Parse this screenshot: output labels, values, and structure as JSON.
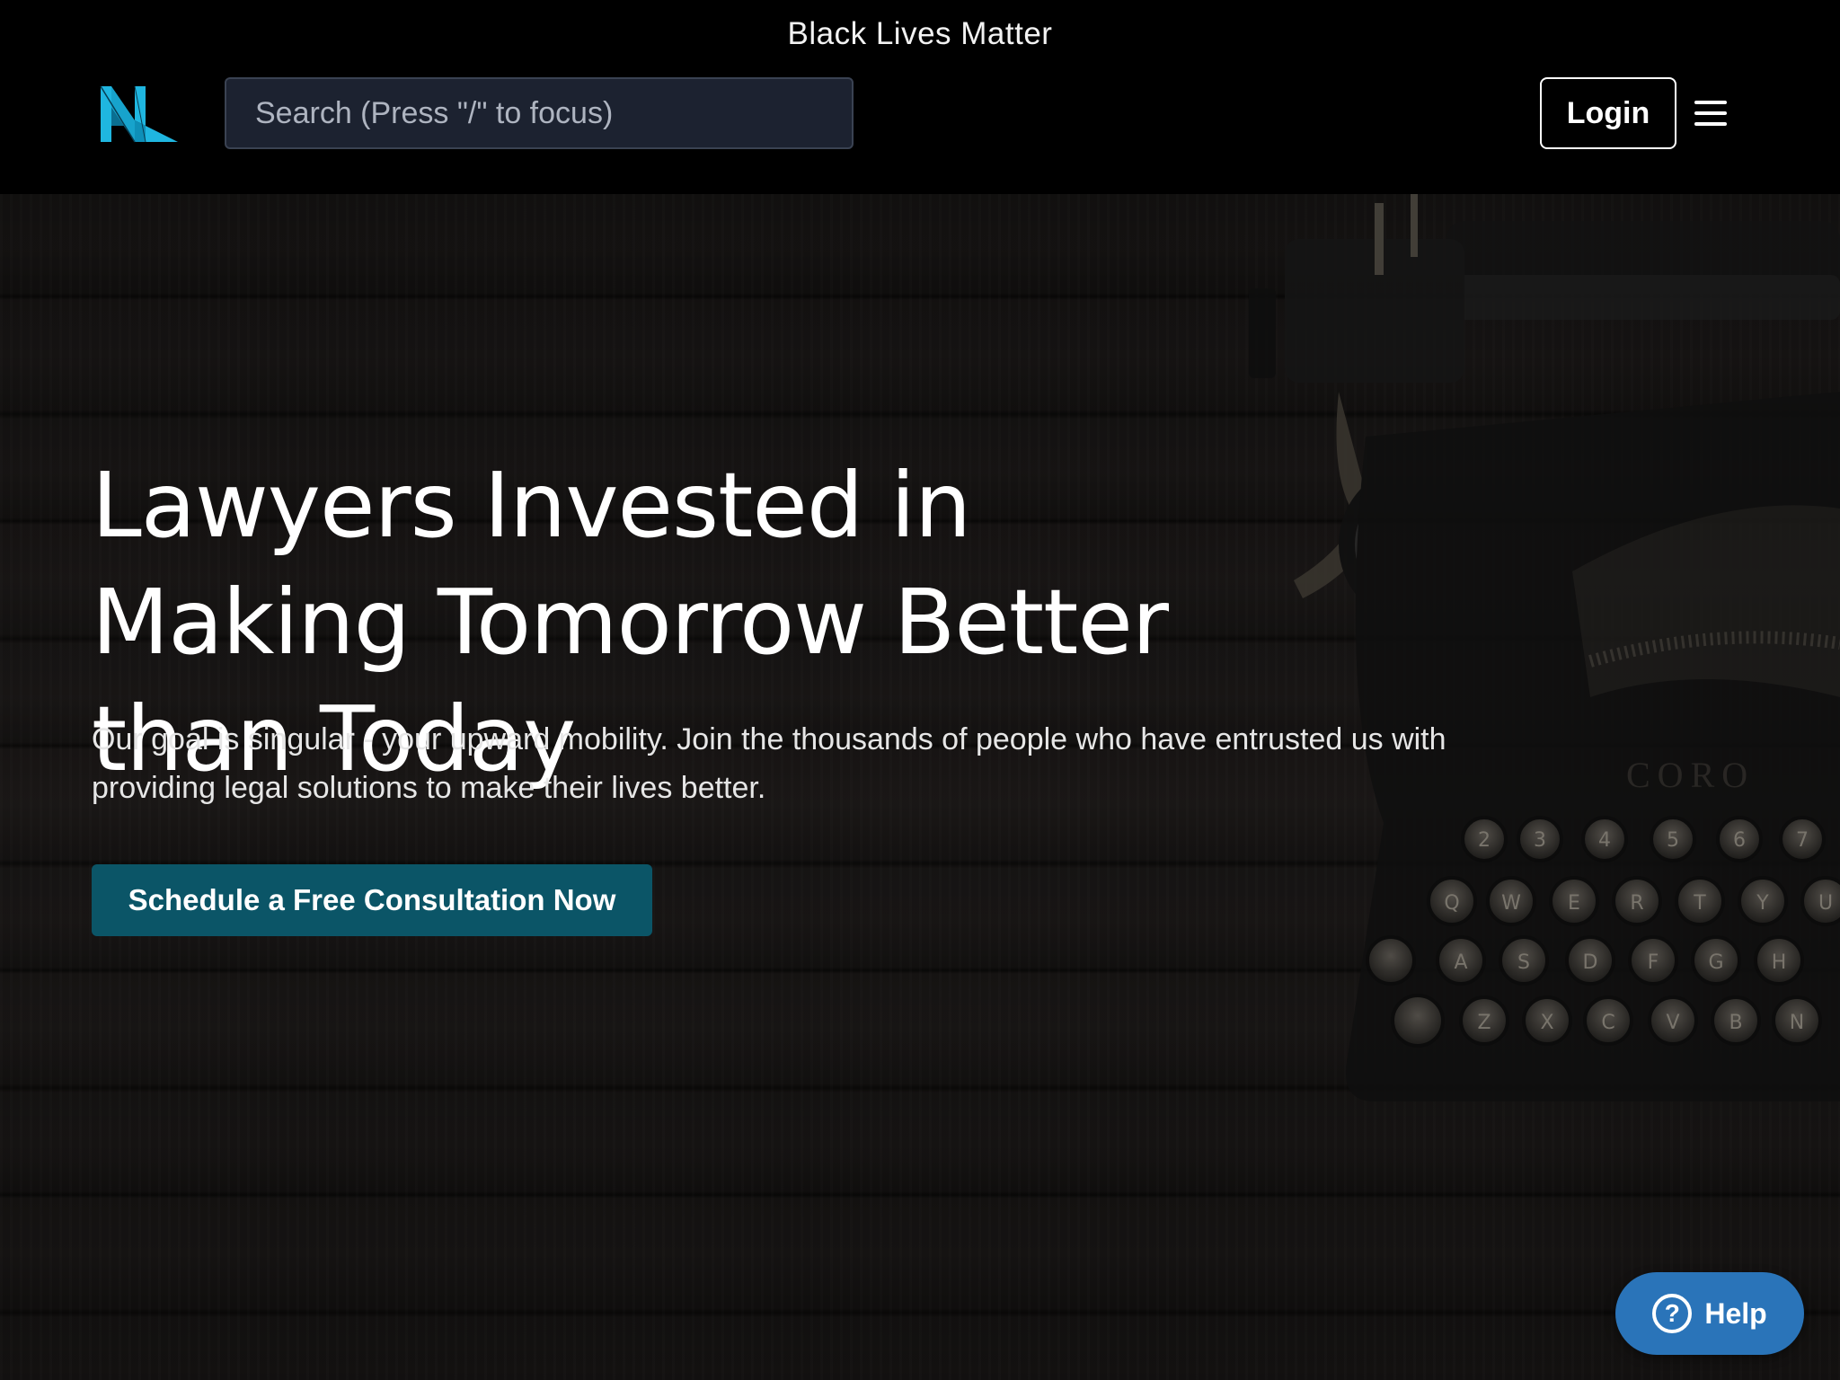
{
  "banner": {
    "text": "Black Lives Matter"
  },
  "header": {
    "logo_icon": "nl-logo-icon",
    "search": {
      "placeholder": "Search (Press \"/\" to focus)",
      "value": ""
    },
    "login_label": "Login",
    "menu_icon": "hamburger-menu-icon"
  },
  "hero": {
    "headline": "Lawyers Invested in Making Tomorrow Better than Today",
    "subtext": "Our goal is singular - your upward mobility. Join the thousands of people who have entrusted us with providing legal solutions to make their lives better.",
    "cta_label": "Schedule a Free Consultation Now",
    "background_image": "typewriter-on-wood"
  },
  "help_widget": {
    "label": "Help",
    "icon": "question-circle-icon"
  },
  "colors": {
    "brand_cyan": "#1fb6e0",
    "cta_teal": "#0b5567",
    "help_blue": "#2a74b9",
    "search_bg": "#1c2230"
  },
  "typewriter_keys": {
    "row1": [
      "2",
      "3",
      "4",
      "5",
      "6",
      "7"
    ],
    "row2": [
      "Q",
      "W",
      "E",
      "R",
      "T",
      "Y",
      "U"
    ],
    "row3": [
      "A",
      "S",
      "D",
      "F",
      "G",
      "H"
    ],
    "row4": [
      "Z",
      "X",
      "C",
      "V",
      "B",
      "N"
    ]
  }
}
